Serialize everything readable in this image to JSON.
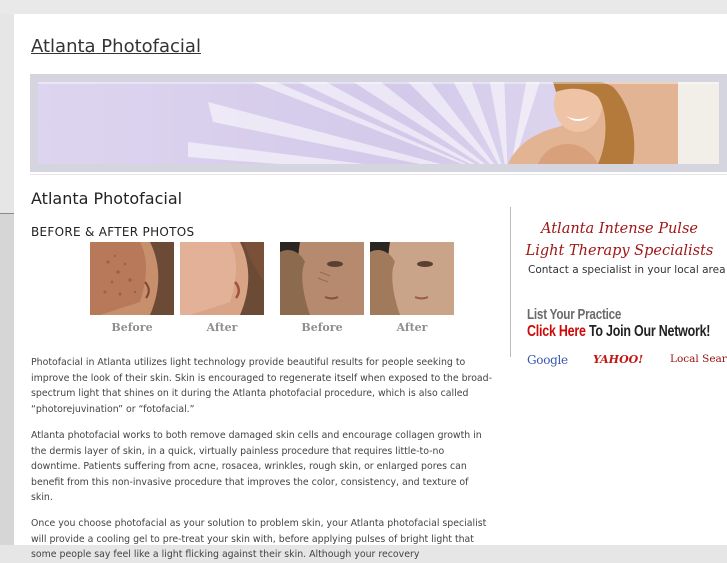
{
  "site": {
    "title": "Atlanta Photofacial"
  },
  "colors": {
    "accent_red": "#a01616",
    "banner_purple": "#e2ddf1"
  },
  "main": {
    "heading": "Atlanta Photofacial",
    "section_heading": "BEFORE & AFTER PHOTOS",
    "photos": [
      {
        "caption": "Before"
      },
      {
        "caption": "After"
      },
      {
        "caption": "Before"
      },
      {
        "caption": "After"
      }
    ],
    "paragraphs": [
      "Photofacial in Atlanta utilizes light technology provide beautiful results for people seeking to improve the look of their skin. Skin is encouraged to regenerate itself when exposed to the broad-spectrum light that shines on it during the Atlanta photofacial procedure, which is also called “photorejuvination” or “fotofacial.”",
      "Atlanta photofacial works to both remove damaged skin cells and encourage collagen growth in the dermis layer of skin, in a quick, virtually painless procedure that requires little-to-no downtime. Patients suffering from acne, rosacea, wrinkles, rough skin, or enlarged pores can benefit from this non-invasive procedure that improves the color, consistency, and texture of skin.",
      "Once you choose photofacial as your solution to problem skin, your Atlanta photofacial specialist will provide a cooling gel to pre-treat your skin with, before applying pulses of bright light that some people say feel like a light flicking against their skin. Although your recovery"
    ]
  },
  "sidebar": {
    "heading_line1": "Atlanta Intense Pulse",
    "heading_line2": "Light Therapy Specialists",
    "subtext": "Contact a specialist in your local area",
    "list_practice": "List Your Practice",
    "click_here": "Click Here",
    "join_network": " To Join Our Network!",
    "engines": {
      "google": "Google",
      "yahoo": "YAHOO!",
      "local": "Local Search"
    }
  }
}
